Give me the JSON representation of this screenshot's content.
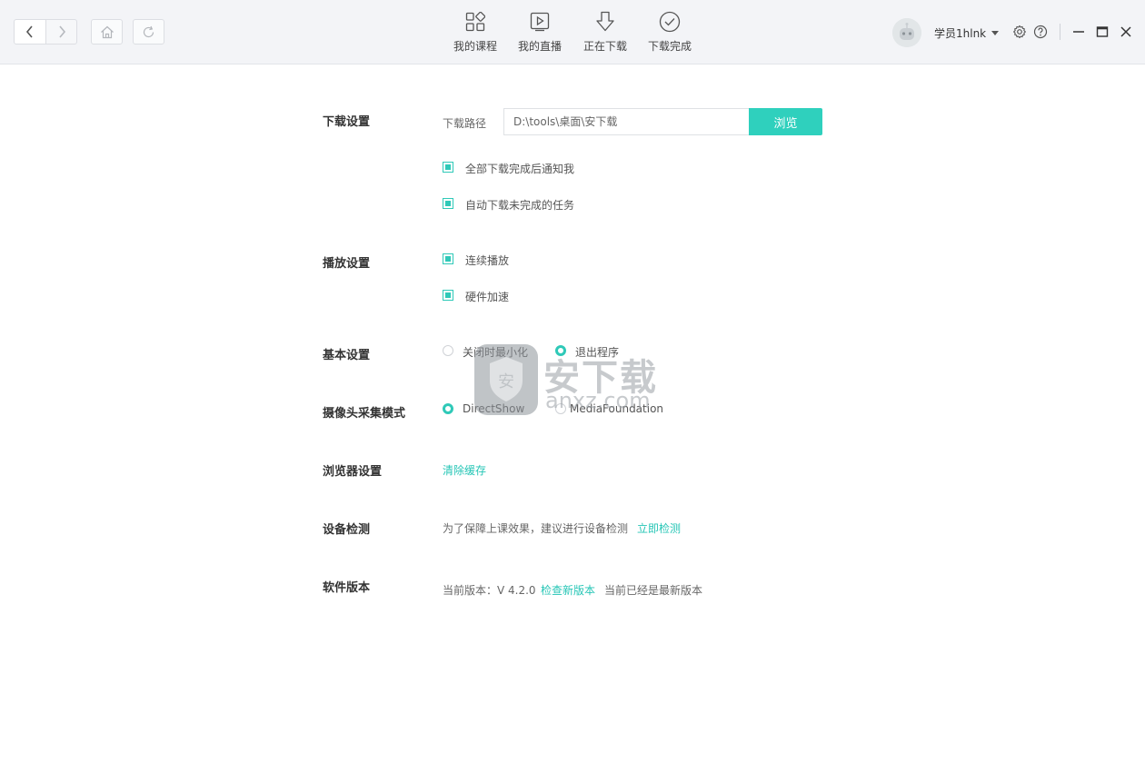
{
  "toolbar": {
    "tabs": [
      {
        "label": "我的课程",
        "icon": "grid-icon"
      },
      {
        "label": "我的直播",
        "icon": "live-play-icon"
      },
      {
        "label": "正在下载",
        "icon": "download-arrow-icon"
      },
      {
        "label": "下载完成",
        "icon": "check-circle-icon"
      }
    ],
    "username": "学员1hlnk",
    "accent_color": "#2fd0bd"
  },
  "settings": {
    "download": {
      "label": "下载设置",
      "path_label": "下载路径",
      "path_value": "D:\\tools\\桌面\\安下载",
      "browse_label": "浏览",
      "opt_notify": "全部下载完成后通知我",
      "opt_notify_checked": true,
      "opt_auto": "自动下载未完成的任务",
      "opt_auto_checked": true
    },
    "playback": {
      "label": "播放设置",
      "opt_continuous": "连续播放",
      "opt_continuous_checked": true,
      "opt_hw": "硬件加速",
      "opt_hw_checked": true
    },
    "basic": {
      "label": "基本设置",
      "opt_minimize": "关闭时最小化",
      "opt_exit": "退出程序",
      "selected": "退出程序"
    },
    "camera": {
      "label": "摄像头采集模式",
      "opt_directshow": "DirectShow",
      "opt_mf": "MediaFoundation",
      "selected": "DirectShow"
    },
    "browser": {
      "label": "浏览器设置",
      "clear_cache": "清除缓存"
    },
    "device": {
      "label": "设备检测",
      "hint": "为了保障上课效果，建议进行设备检测",
      "check_now": "立即检测"
    },
    "version": {
      "label": "软件版本",
      "current": "当前版本：V 4.2.0",
      "check_new": "检查新版本",
      "status": "当前已经是最新版本"
    }
  },
  "watermark": {
    "text": "安下载",
    "sub": "anxz.com"
  }
}
